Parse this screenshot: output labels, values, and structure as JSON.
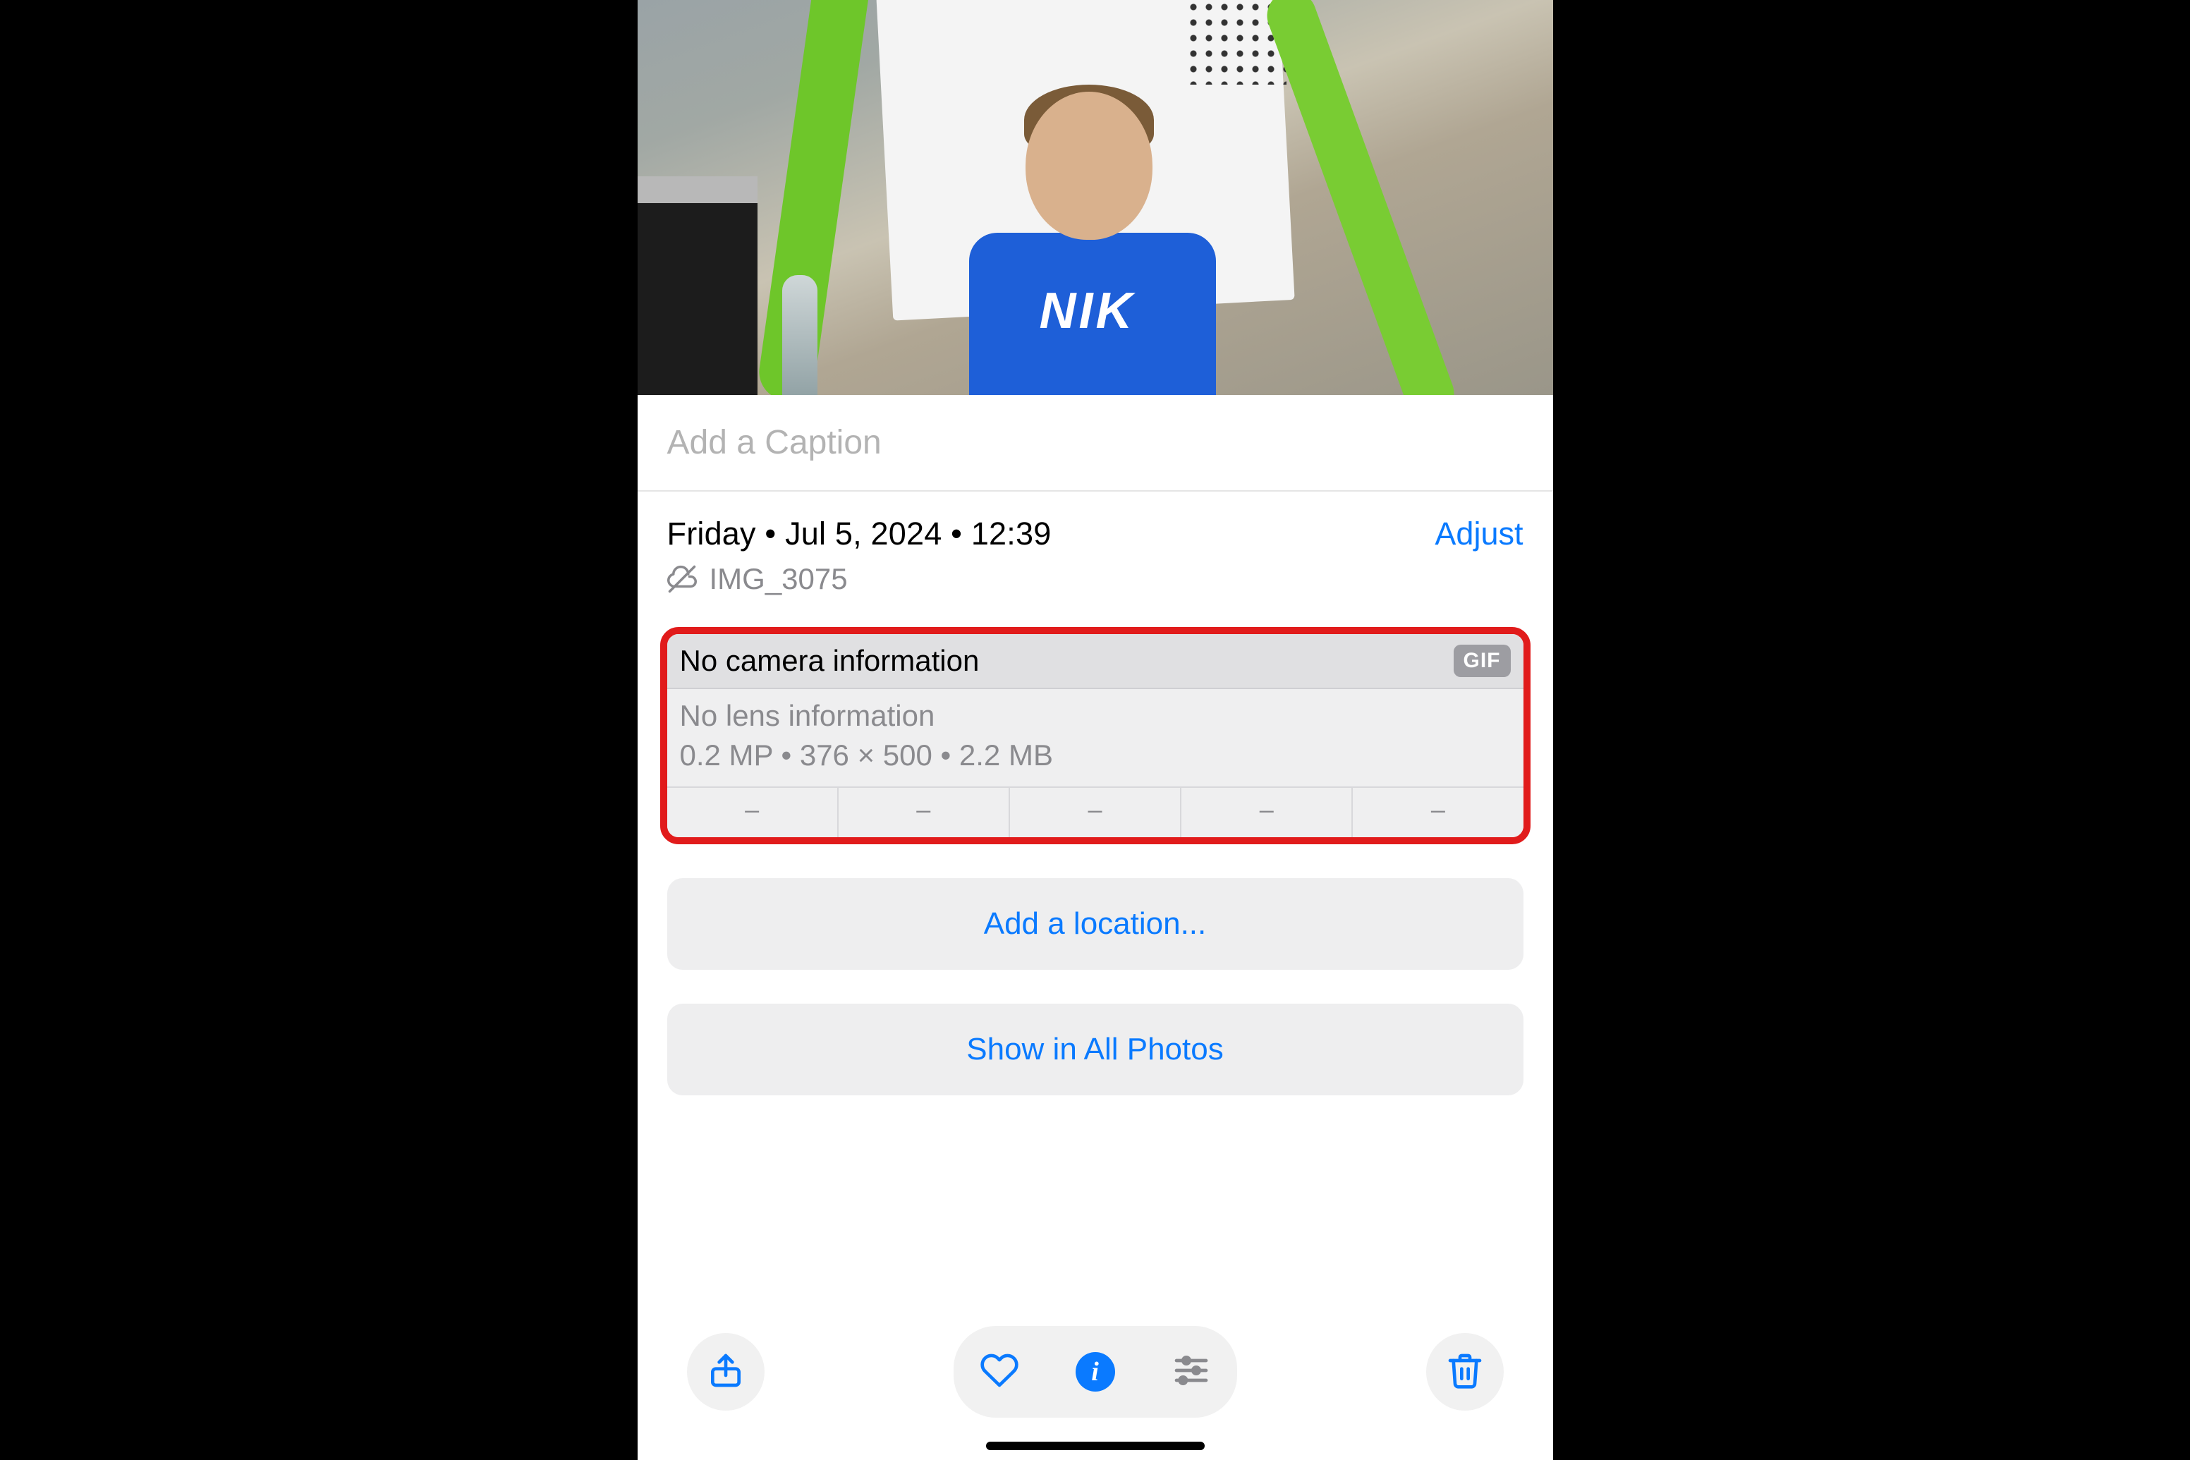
{
  "caption": {
    "placeholder": "Add a Caption"
  },
  "info": {
    "day": "Friday",
    "sep1": " • ",
    "date": "Jul 5, 2024",
    "sep2": " • ",
    "time": "12:39",
    "adjust_label": "Adjust",
    "filename": "IMG_3075"
  },
  "details": {
    "camera": "No camera information",
    "format_badge": "GIF",
    "lens": "No lens information",
    "mp": "0.2 MP",
    "dim": "376 × 500",
    "size": "2.2 MB",
    "cells": [
      "–",
      "–",
      "–",
      "–",
      "–"
    ]
  },
  "buttons": {
    "add_location": "Add a location...",
    "show_all": "Show in All Photos"
  },
  "photo_logo": "NIK"
}
